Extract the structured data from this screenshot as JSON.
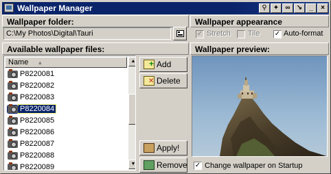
{
  "window": {
    "title": "Wallpaper Manager",
    "buttons": [
      "search-icon",
      "runner-icon",
      "link-icon",
      "resize-icon",
      "minimize-icon",
      "close-icon"
    ]
  },
  "folder": {
    "heading": "Wallpaper folder:",
    "path": "C:\\My Photos\\Digital\\Tauri"
  },
  "files": {
    "heading": "Available wallpaper files:",
    "column_header": "Name",
    "sort_indicator": "▲",
    "items": [
      "P8220081",
      "P8220082",
      "P8220083",
      "P8220084",
      "P8220085",
      "P8220086",
      "P8220087",
      "P8220088",
      "P8220089"
    ],
    "selected": "P8220084"
  },
  "actions": {
    "add": "Add",
    "delete": "Delete",
    "apply": "Apply!",
    "remove": "Remove"
  },
  "appearance": {
    "heading": "Wallpaper appearance",
    "stretch": {
      "label": "Stretch",
      "checked": true,
      "enabled": false
    },
    "tile": {
      "label": "Tile",
      "checked": false,
      "enabled": false
    },
    "autoformat": {
      "label": "Auto-format",
      "checked": true,
      "enabled": true
    }
  },
  "preview": {
    "heading": "Wallpaper preview:"
  },
  "startup": {
    "label": "Change wallpaper on Startup",
    "checked": true
  },
  "colors": {
    "title_bar": "#0a246a",
    "face": "#d4d0c8",
    "selection": "#0a246a",
    "sky": "#8fb1cf"
  }
}
